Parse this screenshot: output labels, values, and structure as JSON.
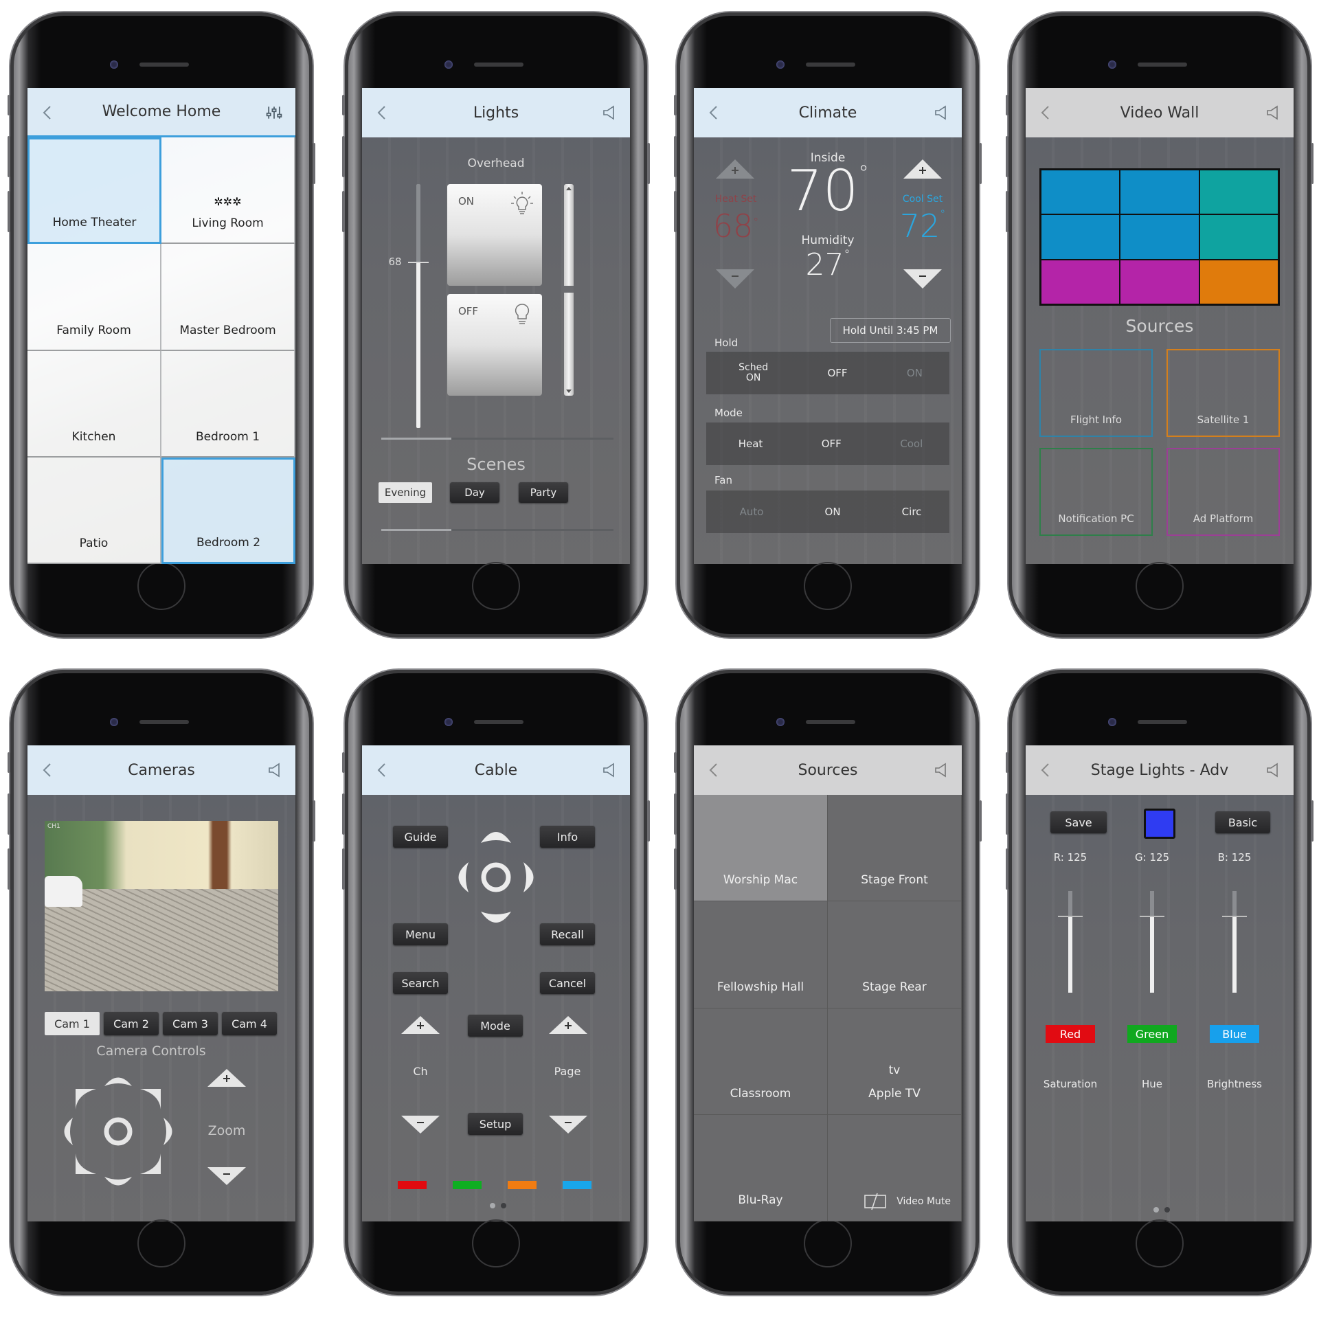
{
  "phones": {
    "welcome": {
      "title": "Welcome Home",
      "left_icon": "back-chevron-icon",
      "right_icon": "sliders-icon",
      "rooms": [
        {
          "label": "Home Theater",
          "icon": "theater-seats-icon",
          "active": true
        },
        {
          "label": "Living Room",
          "icon": "sofa-icon",
          "active": false
        },
        {
          "label": "Family Room",
          "icon": "people-group-icon",
          "active": false
        },
        {
          "label": "Master Bedroom",
          "icon": "double-bed-icon",
          "active": false
        },
        {
          "label": "Kitchen",
          "icon": "chef-hat-icon",
          "active": false
        },
        {
          "label": "Bedroom 1",
          "icon": "single-bed-icon",
          "active": false
        },
        {
          "label": "Patio",
          "icon": "hotdog-icon",
          "active": false
        },
        {
          "label": "Bedroom 2",
          "icon": "single-bed-icon",
          "active": true
        }
      ]
    },
    "lights": {
      "title": "Lights",
      "section": "Overhead",
      "dimmer_value": "68",
      "dimmer_level": 0.68,
      "on_label": "ON",
      "off_label": "OFF",
      "scenes_title": "Scenes",
      "scenes": [
        {
          "label": "Evening",
          "selected": true
        },
        {
          "label": "Day",
          "selected": false
        },
        {
          "label": "Party",
          "selected": false
        }
      ]
    },
    "climate": {
      "title": "Climate",
      "inside_label": "Inside",
      "inside_temp": "70",
      "humidity_label": "Humidity",
      "humidity": "27",
      "heat_set_label": "Heat Set",
      "heat_set": "68",
      "cool_set_label": "Cool Set",
      "cool_set": "72",
      "degree": "°",
      "hold_until": "Hold Until 3:45 PM",
      "hold_label": "Hold",
      "hold_options": [
        {
          "label": "Sched ON",
          "line1": "Sched",
          "line2": "ON",
          "icon": "stopwatch-icon",
          "color": "#1e8fd6",
          "dim": false
        },
        {
          "label": "OFF",
          "icon": "timer-off-icon",
          "color": "#e8920f",
          "dim": false
        },
        {
          "label": "ON",
          "icon": "timer-on-icon",
          "color": "#1f8a52",
          "dim": true
        }
      ],
      "mode_label": "Mode",
      "mode_options": [
        {
          "label": "Heat",
          "icon": "flame-icon",
          "color": "#e8192c",
          "dim": false
        },
        {
          "label": "OFF",
          "icon": "x-icon",
          "color": "#bdbdbd",
          "dim": false
        },
        {
          "label": "Cool",
          "icon": "snowflake-icon",
          "color": "#2a78a8",
          "dim": true
        }
      ],
      "fan_label": "Fan",
      "fan_options": [
        {
          "label": "Auto",
          "icon": "fan-icon",
          "color": "#2a78a8",
          "dim": true
        },
        {
          "label": "ON",
          "icon": "fan-icon",
          "color": "#2fb03a",
          "dim": false
        },
        {
          "label": "Circ",
          "icon": "fan-icon",
          "color": "#f07a1a",
          "dim": false
        }
      ],
      "heat_color": "#b3262e",
      "cool_color": "#2aa7e0"
    },
    "videowall": {
      "title": "Video Wall",
      "wall_cells": [
        "#0f8ec7",
        "#0f8ec7",
        "#0fa3a0",
        "#0f8ec7",
        "#0f8ec7",
        "#0fa3a0",
        "#b424a8",
        "#b424a8",
        "#e07b0c"
      ],
      "sources_title": "Sources",
      "sources": [
        {
          "label": "Flight Info",
          "color": "#2f83a8"
        },
        {
          "label": "Satellite 1",
          "color": "#d47f1c"
        },
        {
          "label": "Notification PC",
          "color": "#2f7f4a"
        },
        {
          "label": "Ad Platform",
          "color": "#9b3f95"
        }
      ]
    },
    "cameras": {
      "title": "Cameras",
      "feed_overlay": "CH1",
      "cams": [
        {
          "label": "Cam 1",
          "selected": true
        },
        {
          "label": "Cam 2",
          "selected": false
        },
        {
          "label": "Cam 3",
          "selected": false
        },
        {
          "label": "Cam 4",
          "selected": false
        }
      ],
      "controls_title": "Camera Controls",
      "zoom_label": "Zoom"
    },
    "cable": {
      "title": "Cable",
      "buttons": {
        "guide": "Guide",
        "info": "Info",
        "menu": "Menu",
        "recall": "Recall",
        "search": "Search",
        "cancel": "Cancel",
        "mode": "Mode",
        "setup": "Setup"
      },
      "ch_label": "Ch",
      "page_label": "Page",
      "color_keys": [
        "#e00a10",
        "#0fae22",
        "#f07c12",
        "#19a6ea"
      ],
      "page_dots": 2,
      "active_page": 1
    },
    "sources": {
      "title": "Sources",
      "items": [
        {
          "label": "Worship Mac",
          "icon": "laptop-icon",
          "selected": true
        },
        {
          "label": "Stage Front",
          "icon": "video-camera-icon",
          "selected": false
        },
        {
          "label": "Fellowship Hall",
          "icon": "video-camera-icon",
          "selected": false
        },
        {
          "label": "Stage Rear",
          "icon": "video-camera-icon",
          "selected": false
        },
        {
          "label": "Classroom",
          "icon": "video-camera-icon",
          "selected": false
        },
        {
          "label": "Apple TV",
          "icon": "apple-tv-icon",
          "selected": false
        },
        {
          "label": "Blu-Ray",
          "icon": "bluray-player-icon",
          "selected": false
        }
      ],
      "video_mute": "Video Mute"
    },
    "stagelights": {
      "title": "Stage Lights - Adv",
      "save": "Save",
      "basic": "Basic",
      "swatch_color": "#2f3cf2",
      "channels": [
        {
          "label": "R: 125",
          "value": 125,
          "name": "Red",
          "color": "#e10b12"
        },
        {
          "label": "G: 125",
          "value": 125,
          "name": "Green",
          "color": "#10a81f"
        },
        {
          "label": "B: 125",
          "value": 125,
          "name": "Blue",
          "color": "#17a0ec"
        }
      ],
      "channel_max": 255,
      "adjusters": [
        "Saturation",
        "Hue",
        "Brightness"
      ],
      "page_dots": 2,
      "active_page": 1
    }
  }
}
